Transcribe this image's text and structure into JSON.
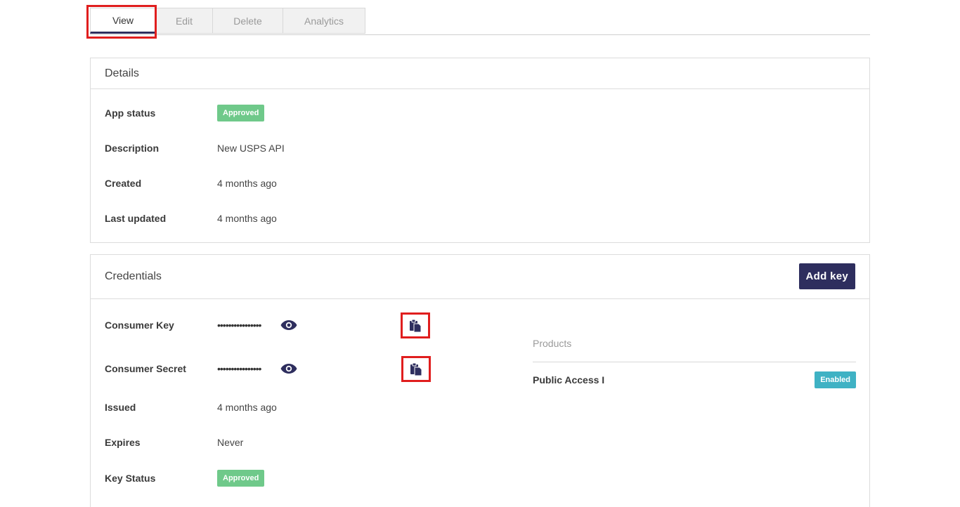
{
  "tabs": [
    {
      "label": "View",
      "active": true
    },
    {
      "label": "Edit",
      "active": false
    },
    {
      "label": "Delete",
      "active": false
    },
    {
      "label": "Analytics",
      "active": false
    }
  ],
  "details": {
    "title": "Details",
    "rows": [
      {
        "label": "App status",
        "badge": "Approved"
      },
      {
        "label": "Description",
        "value": "New USPS API"
      },
      {
        "label": "Created",
        "value": "4 months ago"
      },
      {
        "label": "Last updated",
        "value": "4 months ago"
      }
    ]
  },
  "credentials": {
    "title": "Credentials",
    "add_key_label": "Add key",
    "consumer_key": {
      "label": "Consumer Key",
      "masked": "••••••••••••••••"
    },
    "consumer_secret": {
      "label": "Consumer Secret",
      "masked": "••••••••••••••••"
    },
    "issued": {
      "label": "Issued",
      "value": "4 months ago"
    },
    "expires": {
      "label": "Expires",
      "value": "Never"
    },
    "key_status": {
      "label": "Key Status",
      "badge": "Approved"
    },
    "products": {
      "title": "Products",
      "items": [
        {
          "name": "Public Access I",
          "status": "Enabled"
        }
      ]
    }
  },
  "icons": {
    "reveal": "eye-icon",
    "copy": "clipboard-icon"
  },
  "colors": {
    "primary": "#2e2e5e",
    "approved": "#6fc98a",
    "enabled": "#3fb2c4",
    "highlight": "#e01e1e"
  }
}
